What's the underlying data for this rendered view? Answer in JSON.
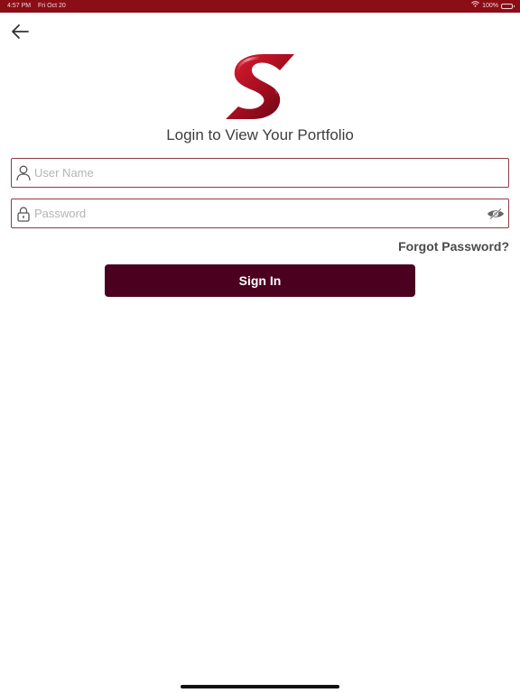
{
  "status_bar": {
    "time": "4:57 PM",
    "date": "Fri Oct 20",
    "battery": "100%",
    "background_color": "#8b0e16"
  },
  "header": {
    "back_icon": "arrow-left-icon",
    "logo_icon": "s-brand-logo"
  },
  "login": {
    "title": "Login to View Your Portfolio",
    "username": {
      "placeholder": "User Name",
      "value": "",
      "icon": "user-icon"
    },
    "password": {
      "placeholder": "Password",
      "value": "",
      "icon": "lock-icon",
      "toggle_icon": "eye-slash-icon"
    },
    "forgot_password": "Forgot Password?",
    "signin_label": "Sign In"
  },
  "colors": {
    "accent": "#4b0020",
    "field_border": "#8e3a48",
    "brand_red": "#c4162a"
  }
}
